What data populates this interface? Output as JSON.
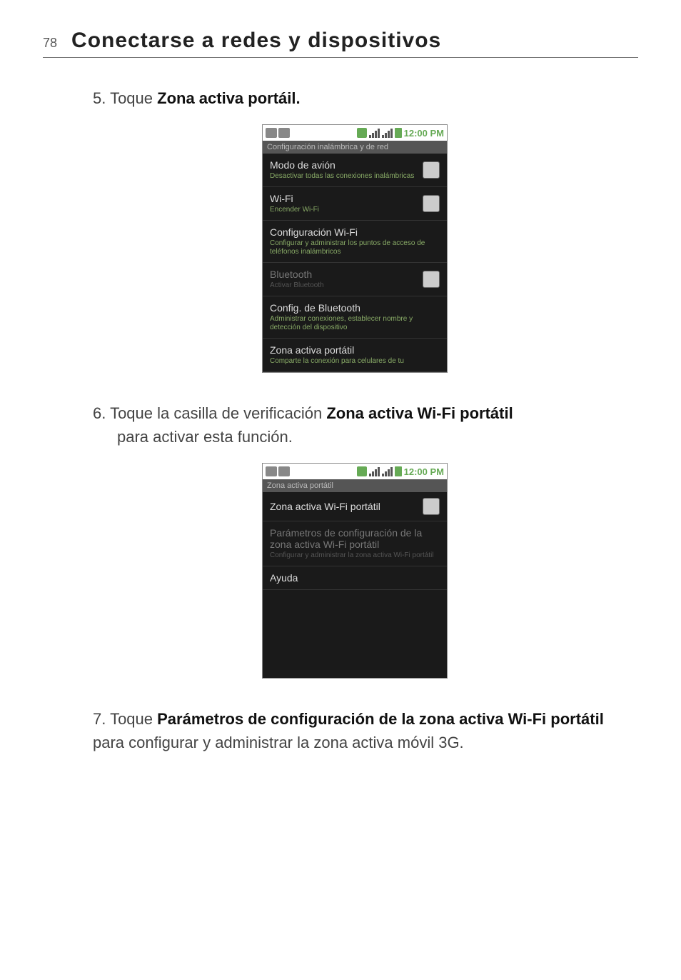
{
  "header": {
    "page_number": "78",
    "title": "Conectarse a redes y dispositivos"
  },
  "step5": {
    "prefix": "5. Toque ",
    "bold": "Zona activa portáil."
  },
  "step6": {
    "prefix": "6. Toque la casilla de verificación ",
    "bold": "Zona activa Wi-Fi portátil",
    "suffix": " para activar esta función."
  },
  "step7": {
    "prefix": "7.  Toque ",
    "bold": "Parámetros de configuración de la zona activa Wi-Fi portátil",
    "suffix": " para configurar y administrar la zona activa móvil 3G."
  },
  "status": {
    "clock": "12:00 PM"
  },
  "shot1": {
    "titlebar": "Configuración inalámbrica y de red",
    "rows": [
      {
        "title": "Modo de avión",
        "sub": "Desactivar todas las conexiones inalámbricas",
        "on": true,
        "check": true
      },
      {
        "title": "Wi-Fi",
        "sub": "Encender Wi-Fi",
        "on": true,
        "check": true
      },
      {
        "title": "Configuración Wi-Fi",
        "sub": "Configurar y administrar los puntos de acceso de teléfonos inalámbricos",
        "on": true,
        "check": false
      },
      {
        "title": "Bluetooth",
        "sub": "Activar Bluetooth",
        "on": false,
        "check": true
      },
      {
        "title": "Config. de Bluetooth",
        "sub": "Administrar conexiones, establecer nombre y detección del dispositivo",
        "on": true,
        "check": false
      },
      {
        "title": "Zona activa portátil",
        "sub": "Comparte la conexión para celulares de tu",
        "on": true,
        "check": false
      }
    ]
  },
  "shot2": {
    "titlebar": "Zona activa portátil",
    "rows": [
      {
        "title": "Zona activa Wi-Fi portátil",
        "sub": "",
        "on": true,
        "check": true
      },
      {
        "title": "Parámetros de configuración de la zona activa Wi-Fi portátil",
        "sub": "Configurar y administrar la zona activa Wi-Fi portátil",
        "on": false,
        "check": false
      },
      {
        "title": "Ayuda",
        "sub": "",
        "on": true,
        "check": false
      }
    ]
  }
}
